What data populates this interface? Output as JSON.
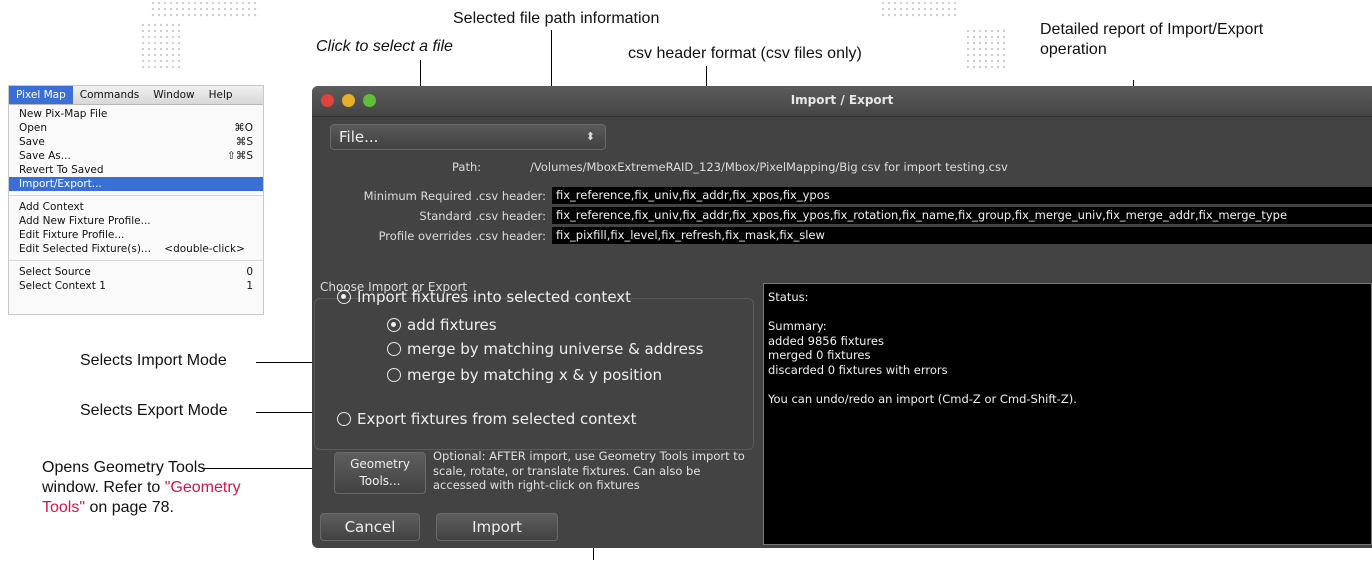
{
  "annotations": {
    "selected_path": "Selected file path information",
    "click_select": "Click to select a file",
    "csv_header": "csv header format (csv files only)",
    "detailed_report": "Detailed report of Import/Export operation",
    "selects_import": "Selects Import Mode",
    "selects_export": "Selects Export Mode",
    "geometry_pre": "Opens Geometry Tools window. Refer to ",
    "geometry_link": "\"Geometry Tools\"",
    "geometry_post": " on page 78."
  },
  "menu": {
    "bar": [
      "Pixel Map",
      "Commands",
      "Window",
      "Help"
    ],
    "group1": [
      {
        "label": "New Pix-Map File",
        "shortcut": ""
      },
      {
        "label": "Open",
        "shortcut": "⌘O"
      },
      {
        "label": "Save",
        "shortcut": "⌘S"
      },
      {
        "label": "Save As...",
        "shortcut": "⇧⌘S"
      },
      {
        "label": "Revert To Saved",
        "shortcut": ""
      },
      {
        "label": "Import/Export...",
        "shortcut": ""
      }
    ],
    "group2": [
      {
        "label": "Add Context",
        "shortcut": ""
      },
      {
        "label": "Add New Fixture Profile...",
        "shortcut": ""
      },
      {
        "label": "Edit Fixture Profile...",
        "shortcut": ""
      },
      {
        "label": "Edit Selected Fixture(s)...    <double-click>",
        "shortcut": ""
      }
    ],
    "group3": [
      {
        "label": "Select Source",
        "shortcut": "0"
      },
      {
        "label": "Select Context 1",
        "shortcut": "1"
      }
    ]
  },
  "dialog": {
    "title": "Import / Export",
    "file_button": "File...",
    "file_arrows": "⬍",
    "path_label": "Path:",
    "path_value": "/Volumes/MboxExtremeRAID_123/Mbox/PixelMapping/Big csv for import testing.csv",
    "min_label": "Minimum Required .csv header:",
    "min_value": "fix_reference,fix_univ,fix_addr,fix_xpos,fix_ypos",
    "std_label": "Standard .csv header:",
    "std_value": "fix_reference,fix_univ,fix_addr,fix_xpos,fix_ypos,fix_rotation,fix_name,fix_group,fix_merge_univ,fix_merge_addr,fix_merge_type",
    "prof_label": "Profile overrides .csv header:",
    "prof_value": "fix_pixfill,fix_level,fix_refresh,fix_mask,fix_slew",
    "choose_header": "Choose Import or Export",
    "import_option": "Import fixtures into selected context",
    "add_fixtures": "add fixtures",
    "merge_universe": "merge by matching universe & address",
    "merge_xy": "merge by matching x & y position",
    "export_option": "Export fixtures from selected context",
    "status_lines": [
      "Status:",
      "",
      "Summary:",
      "added 9856 fixtures",
      "merged 0 fixtures",
      "discarded 0 fixtures with errors",
      "",
      "You can undo/redo an import (Cmd-Z or Cmd-Shift-Z)."
    ],
    "geometry_button_1": "Geometry",
    "geometry_button_2": "Tools...",
    "optional_text": "Optional: AFTER import, use Geometry Tools import to scale, rotate, or translate fixtures. Can also be accessed with right-click on fixtures",
    "cancel_button": "Cancel",
    "import_button": "Import"
  },
  "colors": {
    "menu_highlight": "#3a6fd8",
    "link": "#d4144a",
    "window_bg": "#434343",
    "close": "#e0433b",
    "minimize": "#e7b02b",
    "zoom": "#5fbf3a"
  }
}
